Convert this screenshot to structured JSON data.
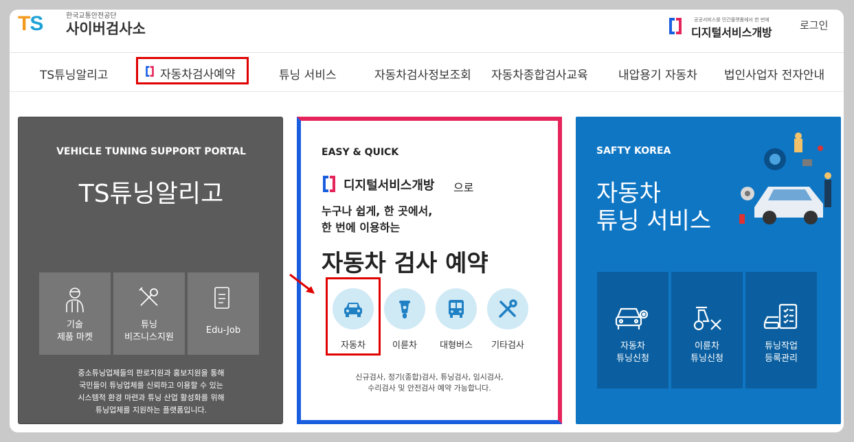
{
  "header": {
    "logo_sub": "한국교통안전공단",
    "logo_title": "사이버검사소",
    "ds_small": "공공서비스를 민간플랫폼에서 한 번에",
    "ds_brand": "디지털서비스개방",
    "login": "로그인"
  },
  "nav": {
    "items": [
      "TS튜닝알리고",
      "자동차검사예약",
      "튜닝 서비스",
      "자동차검사정보조회",
      "자동차종합검사교육",
      "내압용기 자동차",
      "법인사업자 전자안내"
    ]
  },
  "card_left": {
    "subtitle": "VEHICLE TUNING SUPPORT PORTAL",
    "title": "TS튜닝알리고",
    "tiles": [
      {
        "line1": "기술",
        "line2": "제품 마켓"
      },
      {
        "line1": "튜닝",
        "line2": "비즈니스지원"
      },
      {
        "line1": "Edu-Job",
        "line2": ""
      }
    ],
    "desc": [
      "중소튜닝업체들의 판로지원과 홍보지원을 통해",
      "국민들이 튜닝업체를 신뢰하고 이용할 수 있는",
      "시스템적 환경 마련과 튜닝 산업 활성화를 위해",
      "튜닝업체를 지원하는 플랫폼입니다."
    ]
  },
  "card_mid": {
    "easy": "EASY & QUICK",
    "brand": "디지털서비스개방",
    "brand_suffix": "으로",
    "line1": "누구나 쉽게, 한 곳에서,",
    "line2": "한 번에 이용하는",
    "title": "자동차 검사 예약",
    "services": [
      "자동차",
      "이륜차",
      "대형버스",
      "기타검사"
    ],
    "desc": [
      "신규검사, 정기(종합)검사, 튜닝검사, 임시검사,",
      "수리검사 및 안전검사 예약 가능합니다."
    ]
  },
  "card_right": {
    "subtitle": "SAFTY KOREA",
    "title1": "자동차",
    "title2": "튜닝 서비스",
    "tiles": [
      {
        "line1": "자동차",
        "line2": "튜닝신청"
      },
      {
        "line1": "이륜차",
        "line2": "튜닝신청"
      },
      {
        "line1": "튜닝작업",
        "line2": "등록관리"
      }
    ]
  },
  "colors": {
    "accent_red": "#e00000",
    "brand_blue": "#1a5ee0",
    "brand_pink": "#e5245b",
    "portal_blue": "#0f76c4"
  }
}
